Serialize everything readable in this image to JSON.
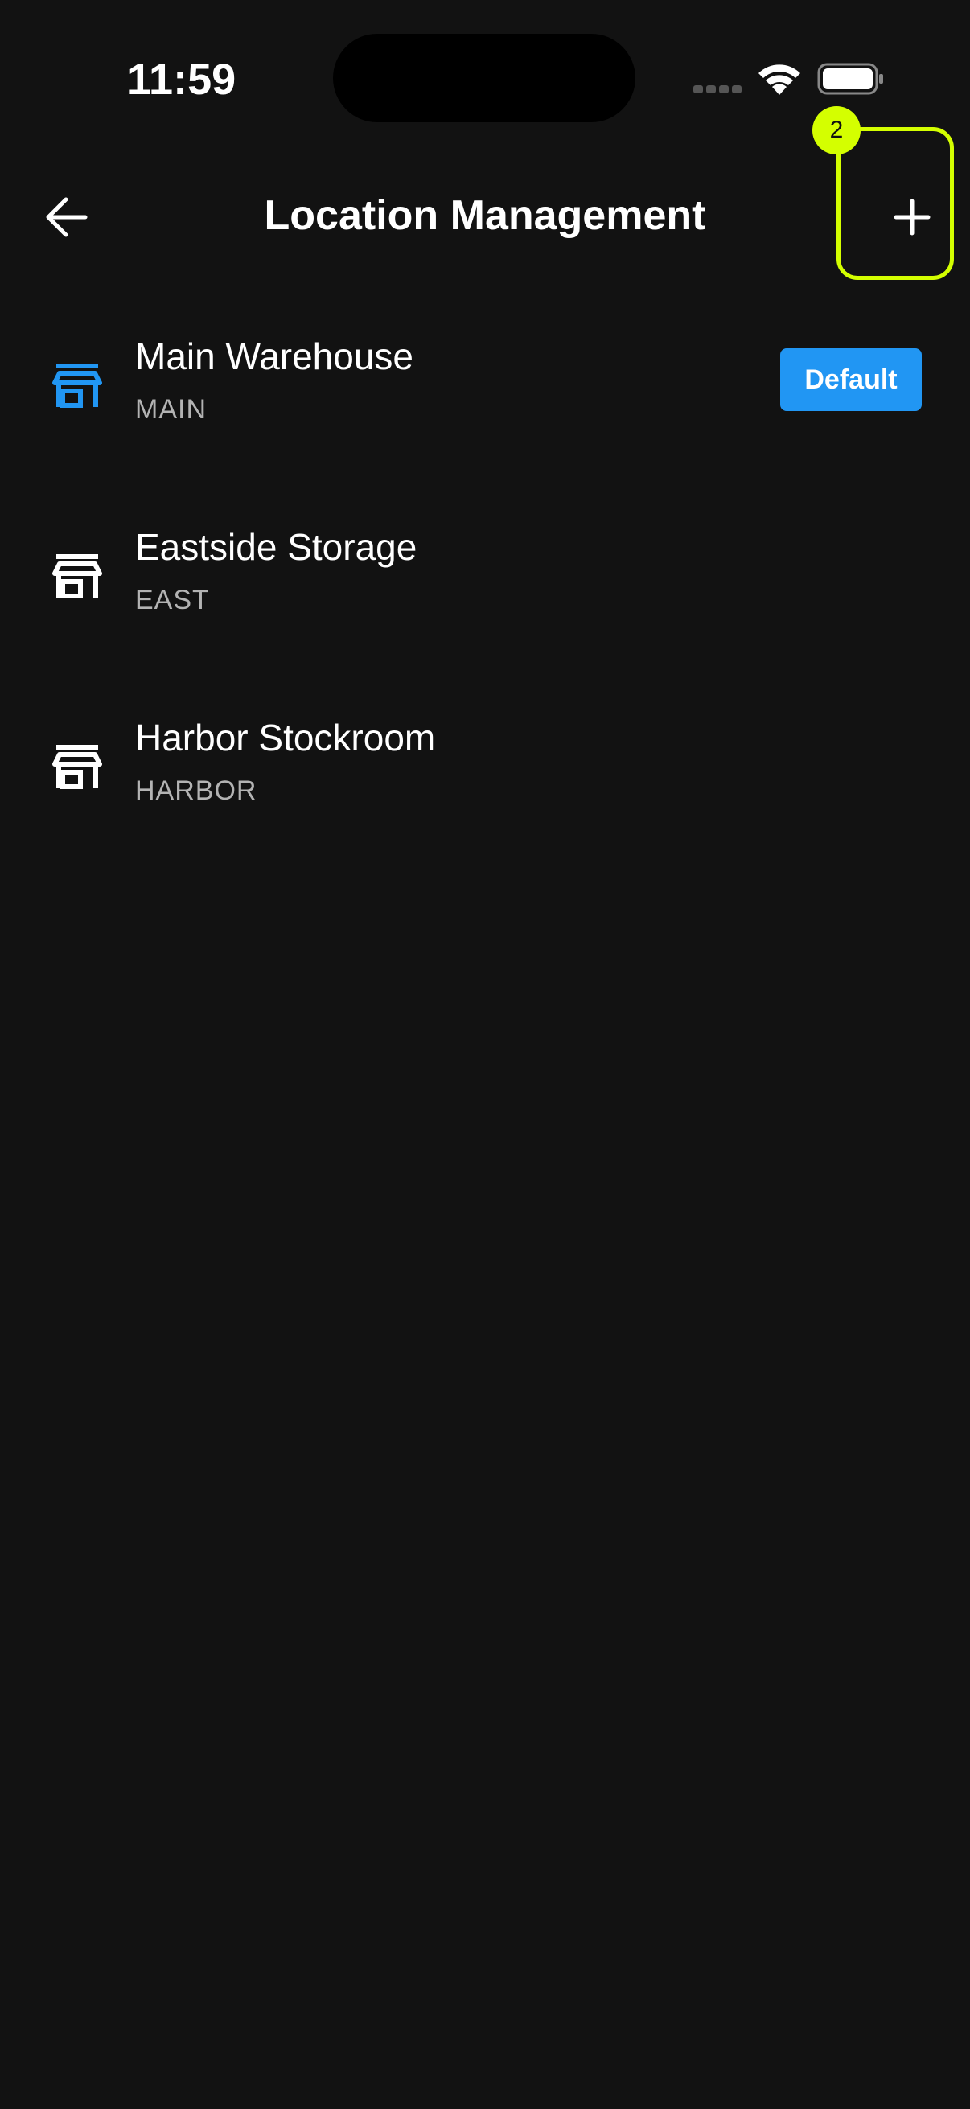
{
  "status_bar": {
    "time": "11:59"
  },
  "app_bar": {
    "title": "Location Management",
    "back_icon": "arrow-left-icon",
    "add_icon": "plus-icon"
  },
  "annotation": {
    "badge_number": "2",
    "color": "#d4ff00"
  },
  "locations": [
    {
      "name": "Main Warehouse",
      "code": "MAIN",
      "badge": "Default",
      "icon": "store-icon",
      "icon_color": "#2196f3"
    },
    {
      "name": "Eastside Storage",
      "code": "EAST",
      "icon": "store-icon",
      "icon_color": "#ffffff"
    },
    {
      "name": "Harbor Stockroom",
      "code": "HARBOR",
      "icon": "store-icon",
      "icon_color": "#ffffff"
    }
  ],
  "colors": {
    "background": "#121212",
    "accent": "#2196f3",
    "secondary_text": "#b3b3b3"
  }
}
